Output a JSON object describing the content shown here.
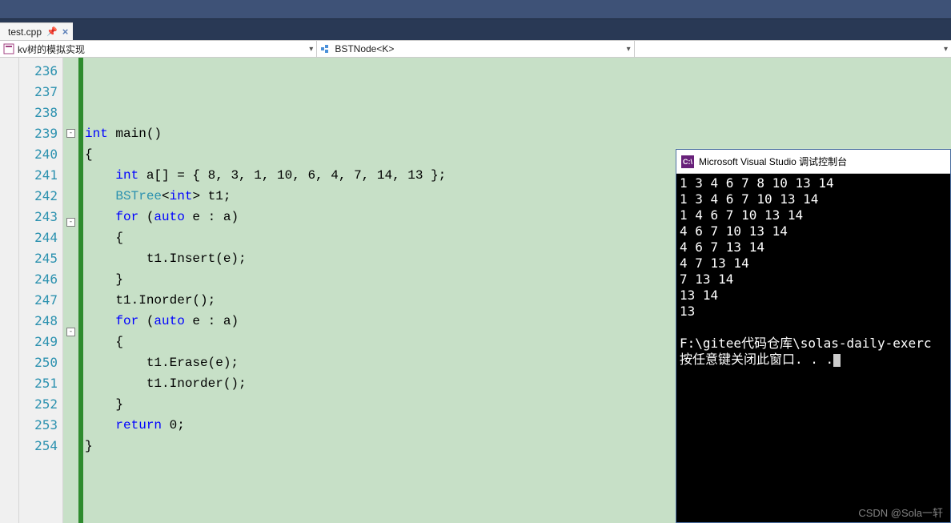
{
  "tab": {
    "label": "test.cpp"
  },
  "dropdowns": {
    "scope": "kv树的模拟实现",
    "type": "BSTNode<K>",
    "member": ""
  },
  "gutter": {
    "start": 236,
    "end": 254
  },
  "code": {
    "lines": [
      "",
      "",
      "",
      "int main()",
      "{",
      "    int a[] = { 8, 3, 1, 10, 6, 4, 7, 14, 13 };",
      "    BSTree<int> t1;",
      "    for (auto e : a)",
      "    {",
      "        t1.Insert(e);",
      "    }",
      "    t1.Inorder();",
      "    for (auto e : a)",
      "    {",
      "        t1.Erase(e);",
      "        t1.Inorder();",
      "    }",
      "    return 0;",
      "}"
    ]
  },
  "console": {
    "title": "Microsoft Visual Studio 调试控制台",
    "output": [
      "1 3 4 6 7 8 10 13 14",
      "1 3 4 6 7 10 13 14",
      "1 4 6 7 10 13 14",
      "4 6 7 10 13 14",
      "4 6 7 13 14",
      "4 7 13 14",
      "7 13 14",
      "13 14",
      "13",
      "",
      "F:\\gitee代码仓库\\solas-daily-exerc",
      "按任意键关闭此窗口. . ."
    ]
  },
  "watermark": "CSDN @Sola一轩"
}
